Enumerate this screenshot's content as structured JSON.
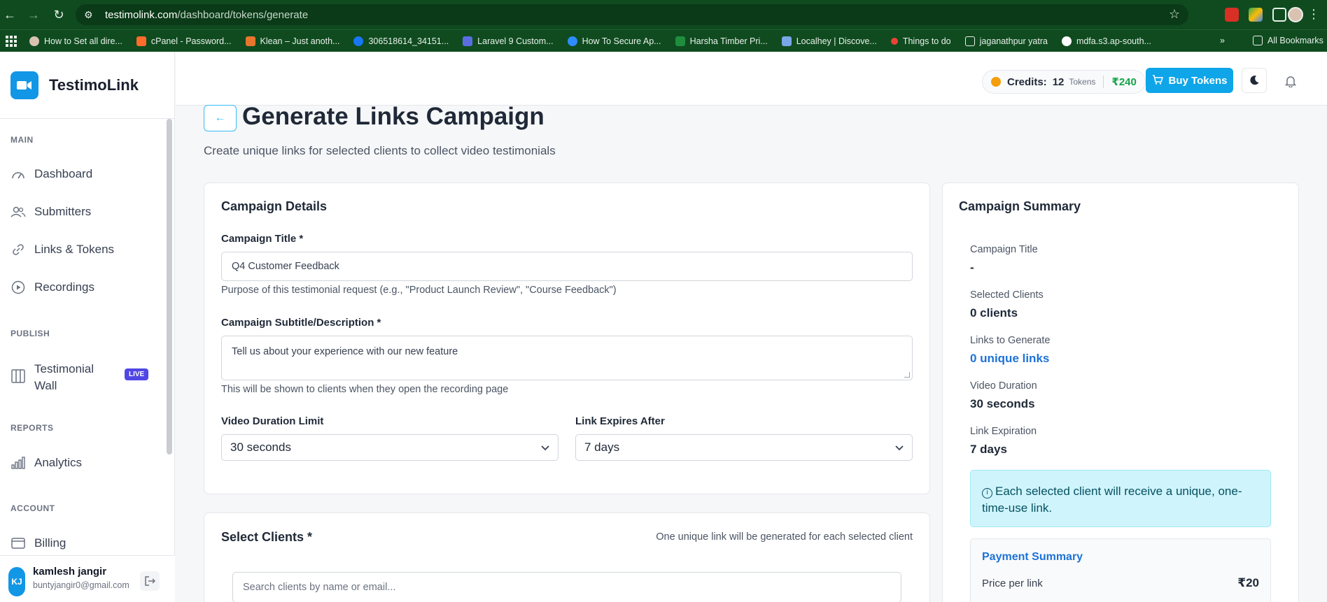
{
  "browser": {
    "url_host": "testimolink.com",
    "url_path": "/dashboard/tokens/generate",
    "bookmarks": [
      {
        "label": "How to Set all dire...",
        "color": "#d9c3b0"
      },
      {
        "label": "cPanel - Password...",
        "color": "#ff6c2c"
      },
      {
        "label": "Klean – Just anoth...",
        "color": "#e8762c"
      },
      {
        "label": "306518614_34151...",
        "color": "#1877f2"
      },
      {
        "label": "Laravel 9 Custom...",
        "color": "#5b6ee1"
      },
      {
        "label": "How To Secure Ap...",
        "color": "#2d8cff"
      },
      {
        "label": "Harsha Timber Pri...",
        "color": "#1e8e3e"
      },
      {
        "label": "Localhey | Discove...",
        "color": "#7aa7e8"
      },
      {
        "label": "Things to do",
        "color": "#ea4335"
      },
      {
        "label": "jaganathpur yatra",
        "color": "#e9f1eb"
      },
      {
        "label": "mdfa.s3.ap-south...",
        "color": "#ffffff"
      }
    ],
    "more_label": "»",
    "all_bookmarks": "All Bookmarks"
  },
  "app": {
    "name": "TestimoLink",
    "accent": "#1296e6"
  },
  "sidebar": {
    "sections": {
      "main": "MAIN",
      "publish": "PUBLISH",
      "reports": "REPORTS",
      "account": "ACCOUNT"
    },
    "items": {
      "dashboard": "Dashboard",
      "submitters": "Submitters",
      "links": "Links & Tokens",
      "recordings": "Recordings",
      "wall_line1": "Testimonial",
      "wall_line2": "Wall",
      "live": "LIVE",
      "analytics": "Analytics",
      "billing": "Billing"
    },
    "user": {
      "initials": "KJ",
      "name": "kamlesh jangir",
      "email": "buntyjangir0@gmail.com"
    }
  },
  "header": {
    "credits_label": "Credits:",
    "credits_count": "12",
    "credits_unit": "Tokens",
    "credits_money": "₹240",
    "buy_label": "Buy Tokens"
  },
  "page": {
    "back": "←",
    "title": "Generate Links Campaign",
    "subtitle": "Create unique links for selected clients to collect video testimonials"
  },
  "details": {
    "title": "Campaign Details",
    "campaign_title_label": "Campaign Title *",
    "campaign_title_value": "Q4 Customer Feedback",
    "campaign_title_help": "Purpose of this testimonial request (e.g., \"Product Launch Review\", \"Course Feedback\")",
    "subtitle_label": "Campaign Subtitle/Description *",
    "subtitle_value": "Tell us about your experience with our new feature",
    "subtitle_help": "This will be shown to clients when they open the recording page",
    "duration_label": "Video Duration Limit",
    "duration_value": "30 seconds",
    "expires_label": "Link Expires After",
    "expires_value": "7 days"
  },
  "clients": {
    "title": "Select Clients *",
    "note": "One unique link will be generated for each selected client",
    "search_placeholder": "Search clients by name or email..."
  },
  "summary": {
    "title": "Campaign Summary",
    "campaign_title_label": "Campaign Title",
    "campaign_title_value": "-",
    "clients_label": "Selected Clients",
    "clients_value": "0 clients",
    "links_label": "Links to Generate",
    "links_value": "0 unique links",
    "duration_label": "Video Duration",
    "duration_value": "30 seconds",
    "expiration_label": "Link Expiration",
    "expiration_value": "7 days",
    "info_text": "Each selected client will receive a unique, one-time-use link.",
    "payment_title": "Payment Summary",
    "price_label": "Price per link",
    "price_value": "₹20"
  }
}
